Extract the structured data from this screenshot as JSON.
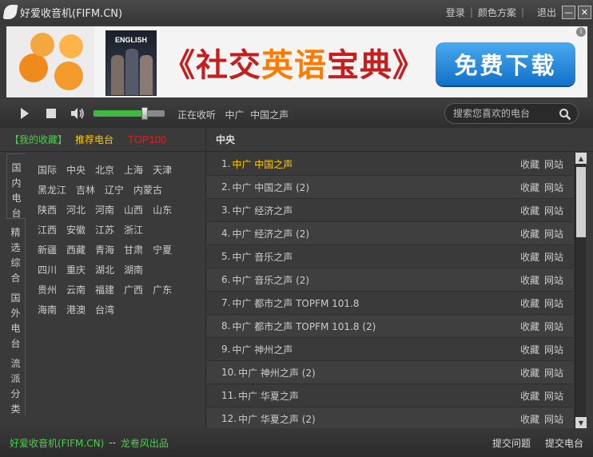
{
  "titlebar": {
    "title": "好爱收音机(FIFM.CN)",
    "login": "登录",
    "sep": "|",
    "color_scheme": "颜色方案",
    "logout": "退出",
    "minimize": "—",
    "close": "✕"
  },
  "banner": {
    "book_title": "ENGLISH",
    "text_pre": "《社交",
    "text_em": "英语",
    "text_post": "宝典》",
    "cta": "免费下载",
    "info": "i"
  },
  "player": {
    "now_playing": "正在收听   中广  中国之声",
    "volume": 0.72,
    "search_placeholder": "搜索您喜欢的电台"
  },
  "left": {
    "tabs": {
      "favorites": "【我的收藏】",
      "recommended": "推荐电台",
      "top": "TOP100"
    },
    "vtabs": [
      "国内电台",
      "精选综合",
      "国外电台",
      "流派分类"
    ],
    "regions": [
      [
        "国际",
        "中央",
        "北京",
        "上海",
        "天津"
      ],
      [
        "黑龙江",
        "吉林",
        "辽宁",
        "内蒙古"
      ],
      [
        "陕西",
        "河北",
        "河南",
        "山西",
        "山东"
      ],
      [
        "江西",
        "安徽",
        "江苏",
        "浙江"
      ],
      [
        "新疆",
        "西藏",
        "青海",
        "甘肃",
        "宁夏"
      ],
      [
        "四川",
        "重庆",
        "湖北",
        "湖南"
      ],
      [
        "贵州",
        "云南",
        "福建",
        "广西",
        "广东"
      ],
      [
        "海南",
        "港澳",
        "台湾"
      ]
    ]
  },
  "right": {
    "header": "中央",
    "fav_label": "收藏",
    "site_label": "网站",
    "stations": [
      {
        "num": "1.",
        "name": "中广  中国之声"
      },
      {
        "num": "2.",
        "name": "中广  中国之声 (2)"
      },
      {
        "num": "3.",
        "name": "中广  经济之声"
      },
      {
        "num": "4.",
        "name": "中广  经济之声 (2)"
      },
      {
        "num": "5.",
        "name": "中广  音乐之声"
      },
      {
        "num": "6.",
        "name": "中广  音乐之声 (2)"
      },
      {
        "num": "7.",
        "name": "中广  都市之声  TOPFM 101.8"
      },
      {
        "num": "8.",
        "name": "中广  都市之声  TOPFM 101.8 (2)"
      },
      {
        "num": "9.",
        "name": "中广  神州之声"
      },
      {
        "num": "10.",
        "name": "中广  神州之声 (2)"
      },
      {
        "num": "11.",
        "name": "中广  华夏之声"
      },
      {
        "num": "12.",
        "name": "中广  华夏之声 (2)"
      }
    ]
  },
  "status": {
    "left": "好爱收音机(FIFM.CN)",
    "sep": "--",
    "credit": "龙卷风出品",
    "report": "提交问题",
    "submit": "提交电台"
  },
  "colors": {
    "green": "#4ad04a",
    "yellow": "#ffcc00",
    "red": "#e02020",
    "blue_cta": "#1e88e5"
  }
}
